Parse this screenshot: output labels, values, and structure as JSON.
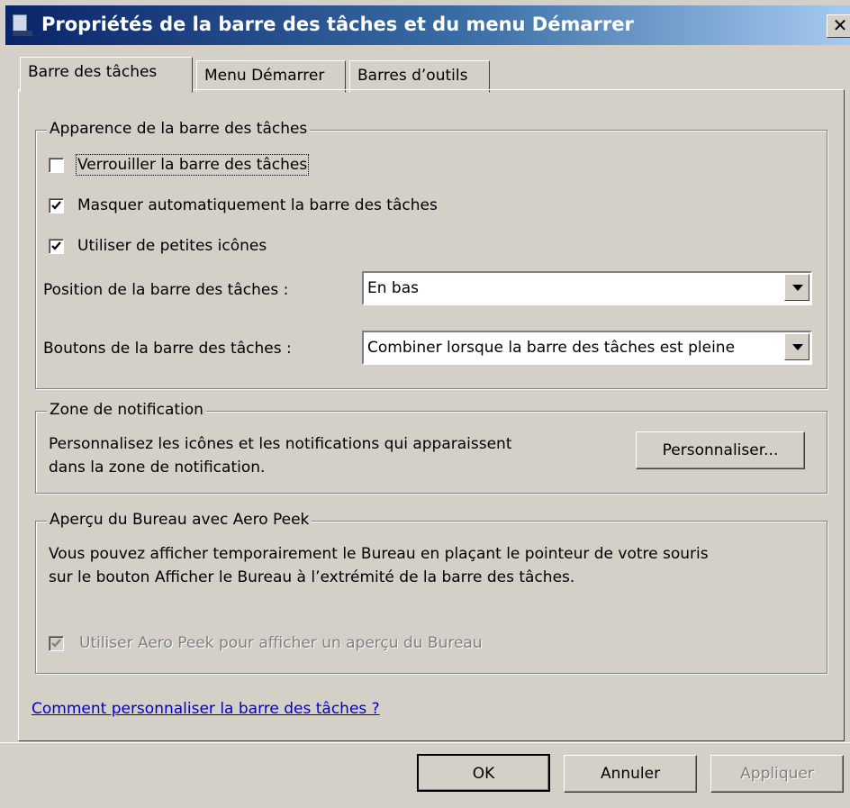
{
  "window": {
    "title": "Propriétés de la barre des tâches et du menu Démarrer",
    "close_glyph": "✕"
  },
  "tabs": [
    {
      "label": "Barre des tâches",
      "selected": true
    },
    {
      "label": "Menu Démarrer",
      "selected": false
    },
    {
      "label": "Barres d’outils",
      "selected": false
    }
  ],
  "appearance": {
    "legend": "Apparence de la barre des tâches",
    "lock": {
      "label": "Verrouiller la barre des tâches",
      "checked": false
    },
    "autohide": {
      "label": "Masquer automatiquement la barre des tâches",
      "checked": true
    },
    "small_icons": {
      "label": "Utiliser de petites icônes",
      "checked": true
    },
    "position": {
      "label": "Position de la barre des tâches :",
      "value": "En bas"
    },
    "buttons": {
      "label": "Boutons de la barre des tâches :",
      "value": "Combiner lorsque la barre des tâches est pleine"
    }
  },
  "notification": {
    "legend": "Zone de notification",
    "desc_line1": "Personnalisez les icônes et les notifications qui apparaissent",
    "desc_line2": "dans la zone de notification.",
    "customize_button": "Personnaliser..."
  },
  "aero": {
    "legend": "Aperçu du Bureau avec Aero Peek",
    "desc_line1": "Vous pouvez afficher temporairement le Bureau en plaçant le pointeur de votre souris",
    "desc_line2": "sur le bouton Afficher le Bureau à l’extrémité de la barre des tâches.",
    "peek": {
      "label": "Utiliser Aero Peek pour afficher un aperçu du Bureau",
      "checked": true,
      "enabled": false
    }
  },
  "help_link": "Comment personnaliser la barre des tâches ?",
  "footer": {
    "ok": "OK",
    "cancel": "Annuler",
    "apply": "Appliquer"
  },
  "colors": {
    "face": "#d4d0c8",
    "title_start": "#0a246a",
    "title_end": "#a6caf0",
    "link": "#0000cc"
  }
}
